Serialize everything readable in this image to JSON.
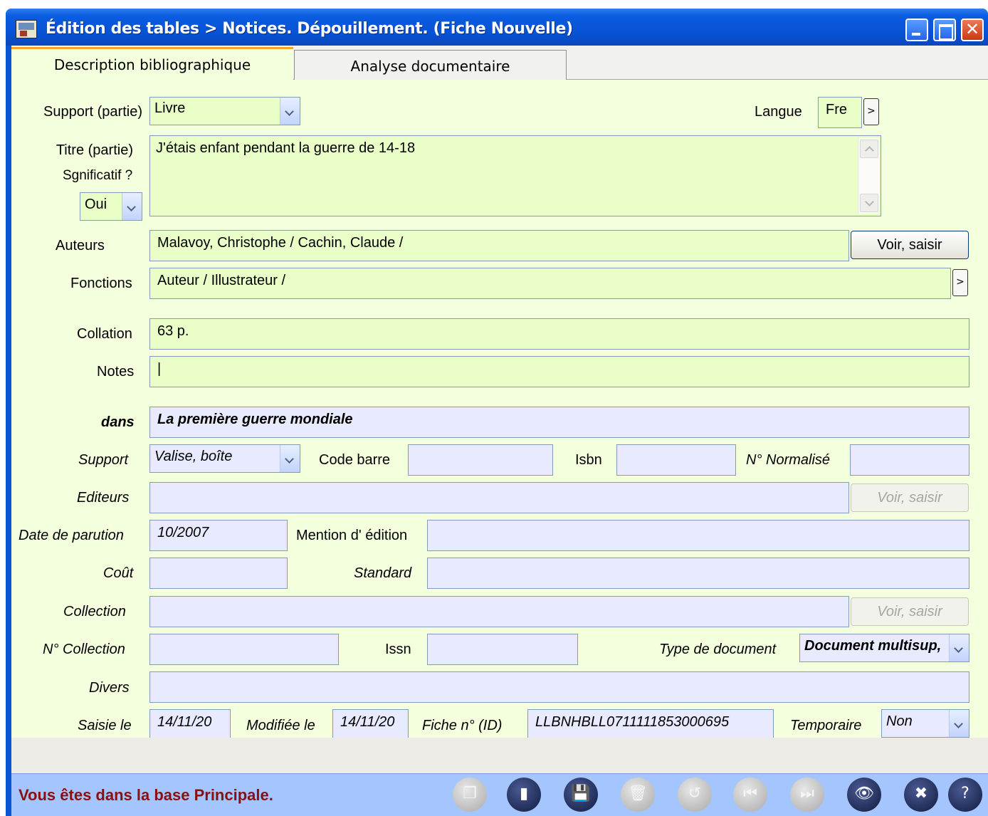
{
  "window": {
    "title": "Édition des tables > Notices. Dépouillement.  (Fiche Nouvelle)",
    "close_glyph": "✕"
  },
  "tabs": [
    {
      "label": "Description bibliographique",
      "active": true
    },
    {
      "label": "Analyse documentaire",
      "active": false
    }
  ],
  "part": {
    "support_label": "Support (partie)",
    "support_value": "Livre",
    "langue_label": "Langue",
    "langue_value": "Fre",
    "langue_btn": ">",
    "titre_label": "Titre (partie)",
    "titre_value": "J'étais enfant pendant la guerre de 14-18",
    "significatif_label": "Sgnificatif ?",
    "significatif_value": "Oui",
    "auteurs_label": "Auteurs",
    "auteurs_value": "Malavoy, Christophe / Cachin, Claude /",
    "auteurs_btn": "Voir, saisir",
    "fonctions_label": "Fonctions",
    "fonctions_value": "Auteur / Illustrateur /",
    "fonctions_btn": ">",
    "collation_label": "Collation",
    "collation_value": "63 p.",
    "notes_label": "Notes",
    "notes_value": "|"
  },
  "host": {
    "dans_label": "dans",
    "dans_value": "La première guerre mondiale",
    "support_label": "Support",
    "support_value": "Valise, boîte",
    "codebarre_label": "Code barre",
    "codebarre_value": "",
    "isbn_label": "Isbn",
    "isbn_value": "",
    "normalise_label": "N° Normalisé",
    "normalise_value": "",
    "editeurs_label": "Editeurs",
    "editeurs_value": "",
    "editeurs_btn": "Voir, saisir",
    "date_label": "Date de parution",
    "date_value": "10/2007",
    "mention_label": "Mention d' édition",
    "mention_value": "",
    "cout_label": "Coût",
    "cout_value": "",
    "standard_label": "Standard",
    "standard_value": "",
    "collection_label": "Collection",
    "collection_value": "",
    "collection_btn": "Voir, saisir",
    "ncollection_label": "N° Collection",
    "ncollection_value": "",
    "issn_label": "Issn",
    "issn_value": "",
    "typedoc_label": "Type de document",
    "typedoc_value": "Document multisup,",
    "divers_label": "Divers",
    "divers_value": "",
    "saisie_label": "Saisie le",
    "saisie_value": "14/11/20",
    "modifiee_label": "Modifiée le",
    "modifiee_value": "14/11/20",
    "fiche_label": "Fiche n° (ID)",
    "fiche_value": "LLBNHBLL0711111853000695",
    "temporaire_label": "Temporaire",
    "temporaire_value": "Non"
  },
  "status": {
    "message": "Vous êtes dans la base Principale.",
    "color": "#8b0f0f"
  },
  "toolbar": [
    {
      "name": "copy-icon",
      "glyph": "❐",
      "enabled": false
    },
    {
      "name": "new-record-icon",
      "glyph": "▮",
      "enabled": true
    },
    {
      "name": "save-icon",
      "glyph": "💾",
      "enabled": true
    },
    {
      "name": "delete-icon",
      "glyph": "🗑",
      "enabled": false
    },
    {
      "name": "undo-icon",
      "glyph": "↺",
      "enabled": false
    },
    {
      "name": "first-record-icon",
      "glyph": "⏮",
      "enabled": false
    },
    {
      "name": "next-record-icon",
      "glyph": "⏭",
      "enabled": false
    },
    {
      "name": "preview-icon",
      "glyph": "👁",
      "enabled": true
    },
    {
      "name": "cancel-icon",
      "glyph": "✖",
      "enabled": true
    },
    {
      "name": "help-icon",
      "glyph": "?",
      "enabled": true
    }
  ],
  "colors": {
    "field_green": "#eaffc8",
    "field_blue": "#e8ebff",
    "form_bg": "#f4ffde",
    "titlebar": "#0751d4",
    "statusbar": "#a5c5ff"
  }
}
